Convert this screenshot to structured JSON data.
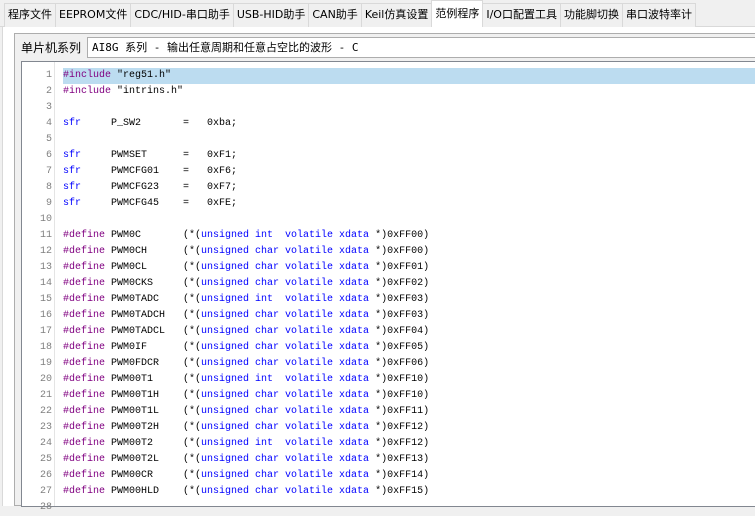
{
  "tabs": [
    "程序文件",
    "EEPROM文件",
    "CDC/HID-串口助手",
    "USB-HID助手",
    "CAN助手",
    "Keil仿真设置",
    "范例程序",
    "I/O口配置工具",
    "功能脚切换",
    "串口波特率计"
  ],
  "active_tab": 6,
  "series_label": "单片机系列",
  "series_value": "AI8G 系列 - 输出任意周期和任意占空比的波形 - C",
  "colors": {
    "preprocessor": "#800080",
    "keyword": "#0000ff",
    "current_line": "#bcdcf0"
  },
  "code": [
    [
      [
        "#include",
        "pp"
      ],
      [
        " \"reg51.h\"",
        "pl"
      ]
    ],
    [
      [
        "#include",
        "pp"
      ],
      [
        " \"intrins.h\"",
        "pl"
      ]
    ],
    [],
    [
      [
        "sfr",
        "kw"
      ],
      [
        "     P_SW2       =   0xba;",
        "pl"
      ]
    ],
    [],
    [
      [
        "sfr",
        "kw"
      ],
      [
        "     PWMSET      =   0xF1;",
        "pl"
      ]
    ],
    [
      [
        "sfr",
        "kw"
      ],
      [
        "     PWMCFG01    =   0xF6;",
        "pl"
      ]
    ],
    [
      [
        "sfr",
        "kw"
      ],
      [
        "     PWMCFG23    =   0xF7;",
        "pl"
      ]
    ],
    [
      [
        "sfr",
        "kw"
      ],
      [
        "     PWMCFG45    =   0xFE;",
        "pl"
      ]
    ],
    [],
    [
      [
        "#define",
        "pp"
      ],
      [
        " PWM0C       (*(",
        "pl"
      ],
      [
        "unsigned int  volatile xdata",
        "kw"
      ],
      [
        " *)0xFF00)",
        "pl"
      ]
    ],
    [
      [
        "#define",
        "pp"
      ],
      [
        " PWM0CH      (*(",
        "pl"
      ],
      [
        "unsigned char volatile xdata",
        "kw"
      ],
      [
        " *)0xFF00)",
        "pl"
      ]
    ],
    [
      [
        "#define",
        "pp"
      ],
      [
        " PWM0CL      (*(",
        "pl"
      ],
      [
        "unsigned char volatile xdata",
        "kw"
      ],
      [
        " *)0xFF01)",
        "pl"
      ]
    ],
    [
      [
        "#define",
        "pp"
      ],
      [
        " PWM0CKS     (*(",
        "pl"
      ],
      [
        "unsigned char volatile xdata",
        "kw"
      ],
      [
        " *)0xFF02)",
        "pl"
      ]
    ],
    [
      [
        "#define",
        "pp"
      ],
      [
        " PWM0TADC    (*(",
        "pl"
      ],
      [
        "unsigned int  volatile xdata",
        "kw"
      ],
      [
        " *)0xFF03)",
        "pl"
      ]
    ],
    [
      [
        "#define",
        "pp"
      ],
      [
        " PWM0TADCH   (*(",
        "pl"
      ],
      [
        "unsigned char volatile xdata",
        "kw"
      ],
      [
        " *)0xFF03)",
        "pl"
      ]
    ],
    [
      [
        "#define",
        "pp"
      ],
      [
        " PWM0TADCL   (*(",
        "pl"
      ],
      [
        "unsigned char volatile xdata",
        "kw"
      ],
      [
        " *)0xFF04)",
        "pl"
      ]
    ],
    [
      [
        "#define",
        "pp"
      ],
      [
        " PWM0IF      (*(",
        "pl"
      ],
      [
        "unsigned char volatile xdata",
        "kw"
      ],
      [
        " *)0xFF05)",
        "pl"
      ]
    ],
    [
      [
        "#define",
        "pp"
      ],
      [
        " PWM0FDCR    (*(",
        "pl"
      ],
      [
        "unsigned char volatile xdata",
        "kw"
      ],
      [
        " *)0xFF06)",
        "pl"
      ]
    ],
    [
      [
        "#define",
        "pp"
      ],
      [
        " PWM00T1     (*(",
        "pl"
      ],
      [
        "unsigned int  volatile xdata",
        "kw"
      ],
      [
        " *)0xFF10)",
        "pl"
      ]
    ],
    [
      [
        "#define",
        "pp"
      ],
      [
        " PWM00T1H    (*(",
        "pl"
      ],
      [
        "unsigned char volatile xdata",
        "kw"
      ],
      [
        " *)0xFF10)",
        "pl"
      ]
    ],
    [
      [
        "#define",
        "pp"
      ],
      [
        " PWM00T1L    (*(",
        "pl"
      ],
      [
        "unsigned char volatile xdata",
        "kw"
      ],
      [
        " *)0xFF11)",
        "pl"
      ]
    ],
    [
      [
        "#define",
        "pp"
      ],
      [
        " PWM00T2H    (*(",
        "pl"
      ],
      [
        "unsigned char volatile xdata",
        "kw"
      ],
      [
        " *)0xFF12)",
        "pl"
      ]
    ],
    [
      [
        "#define",
        "pp"
      ],
      [
        " PWM00T2     (*(",
        "pl"
      ],
      [
        "unsigned int  volatile xdata",
        "kw"
      ],
      [
        " *)0xFF12)",
        "pl"
      ]
    ],
    [
      [
        "#define",
        "pp"
      ],
      [
        " PWM00T2L    (*(",
        "pl"
      ],
      [
        "unsigned char volatile xdata",
        "kw"
      ],
      [
        " *)0xFF13)",
        "pl"
      ]
    ],
    [
      [
        "#define",
        "pp"
      ],
      [
        " PWM00CR     (*(",
        "pl"
      ],
      [
        "unsigned char volatile xdata",
        "kw"
      ],
      [
        " *)0xFF14)",
        "pl"
      ]
    ],
    [
      [
        "#define",
        "pp"
      ],
      [
        " PWM00HLD    (*(",
        "pl"
      ],
      [
        "unsigned char volatile xdata",
        "kw"
      ],
      [
        " *)0xFF15)",
        "pl"
      ]
    ],
    []
  ]
}
